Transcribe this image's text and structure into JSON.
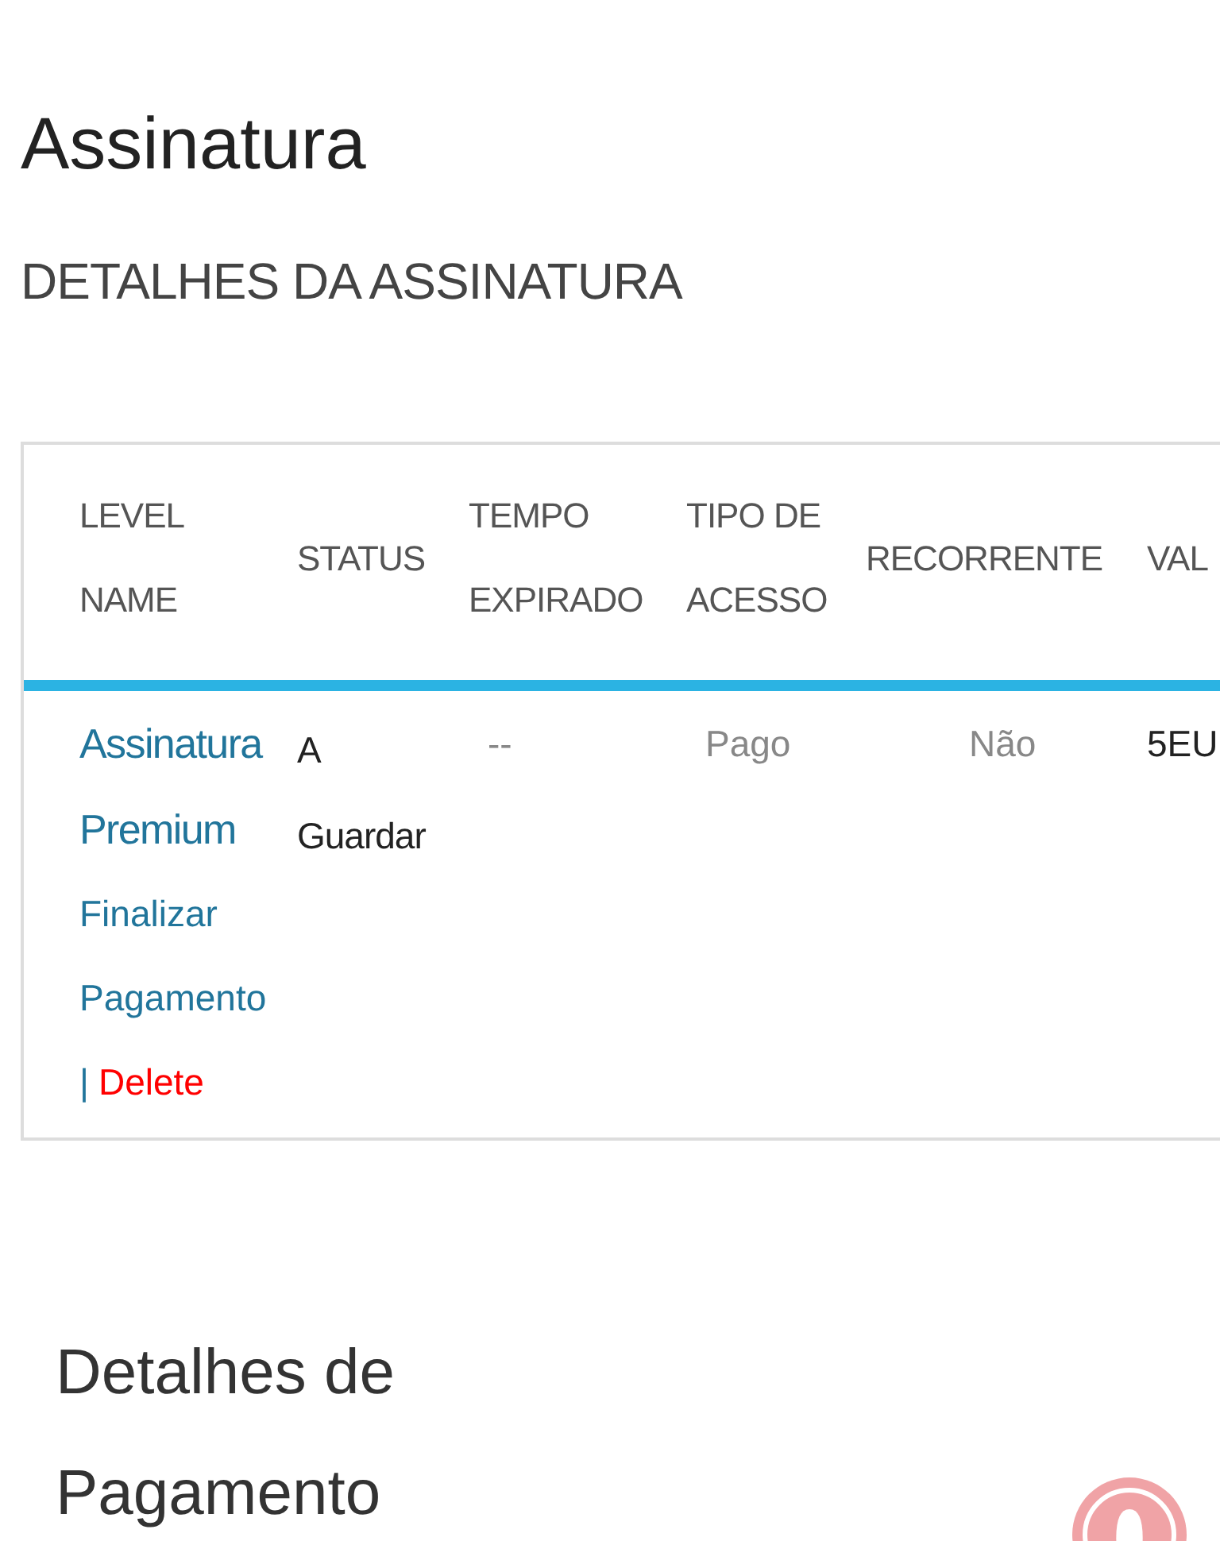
{
  "page_title": "Assinatura",
  "section_title": "DETALHES DA ASSINATURA",
  "table": {
    "columns": [
      "LEVEL NAME",
      "STATUS",
      "TEMPO EXPIRADO",
      "TIPO DE ACESSO",
      "RECORRENTE",
      "VAL"
    ],
    "rows": [
      {
        "level_name": "Assinatura Premium",
        "actions": [
          {
            "kind": "link",
            "label": "Finalizar Pagamento"
          },
          {
            "kind": "danger",
            "separator": "|",
            "label": "Delete"
          }
        ],
        "status": "A Guardar",
        "tempo_expirado": "--",
        "tipo_de_acesso": "Pago",
        "recorrente": "Não",
        "column_6": "5EU"
      }
    ]
  },
  "payment_title": "Detalhes de Pagamento"
}
